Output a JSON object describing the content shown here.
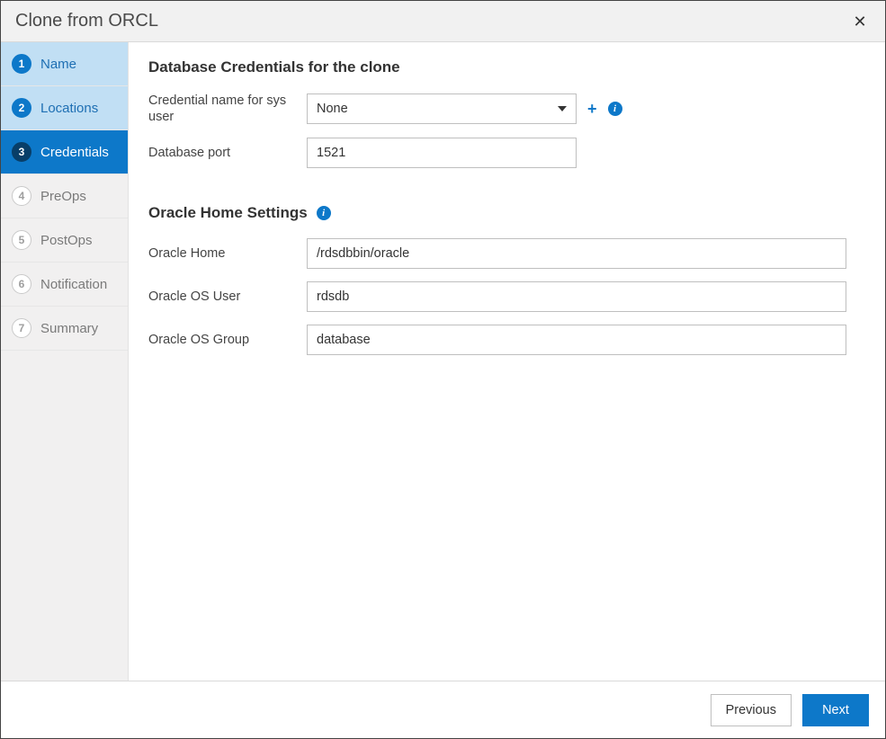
{
  "title": "Clone from ORCL",
  "steps": [
    {
      "num": "1",
      "label": "Name",
      "state": "done"
    },
    {
      "num": "2",
      "label": "Locations",
      "state": "done"
    },
    {
      "num": "3",
      "label": "Credentials",
      "state": "active"
    },
    {
      "num": "4",
      "label": "PreOps",
      "state": "pending"
    },
    {
      "num": "5",
      "label": "PostOps",
      "state": "pending"
    },
    {
      "num": "6",
      "label": "Notification",
      "state": "pending"
    },
    {
      "num": "7",
      "label": "Summary",
      "state": "pending"
    }
  ],
  "credentials": {
    "heading": "Database Credentials for the clone",
    "sys_label": "Credential name for sys user",
    "sys_value": "None",
    "port_label": "Database port",
    "port_value": "1521"
  },
  "oracle": {
    "heading": "Oracle Home Settings",
    "home_label": "Oracle Home",
    "home_value": "/rdsdbbin/oracle",
    "os_user_label": "Oracle OS User",
    "os_user_value": "rdsdb",
    "os_group_label": "Oracle OS Group",
    "os_group_value": "database"
  },
  "buttons": {
    "previous": "Previous",
    "next": "Next"
  }
}
